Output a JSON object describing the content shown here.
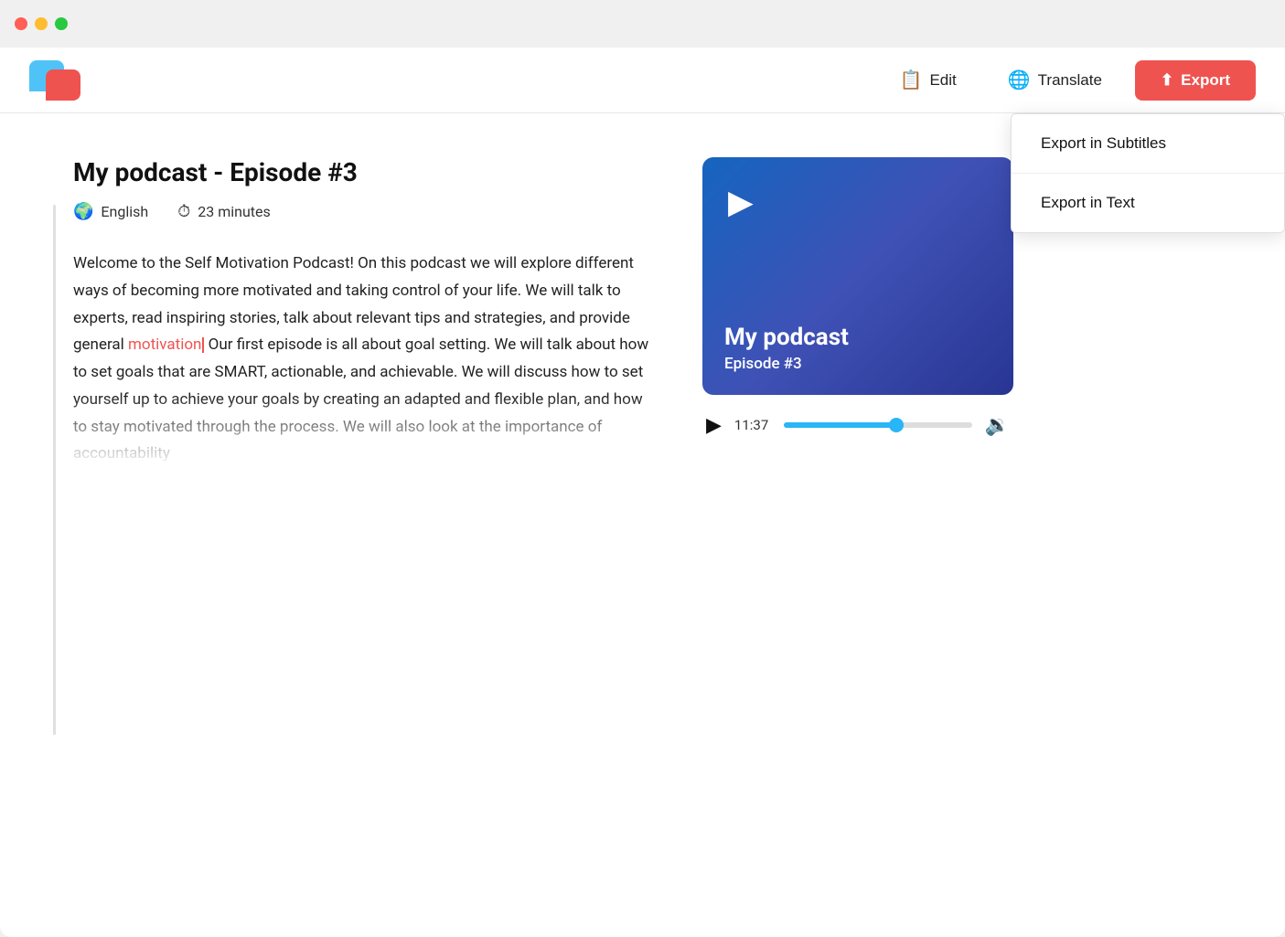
{
  "window": {
    "titlebar": {
      "close_label": "",
      "min_label": "",
      "max_label": ""
    }
  },
  "logo": {
    "alt": "App Logo"
  },
  "navbar": {
    "edit_label": "Edit",
    "translate_label": "Translate",
    "export_label": "Export"
  },
  "dropdown": {
    "export_subtitles": "Export in Subtitles",
    "export_text": "Export in Text"
  },
  "podcast": {
    "title": "My podcast - Episode #3",
    "language": "English",
    "duration": "23 minutes",
    "transcript": "Welcome to the Self Motivation Podcast! On this podcast we will explore different ways of becoming more motivated and taking control of your life. We will talk to experts, read inspiring stories, talk about relevant tips and strategies, and provide general ",
    "highlight": "motivation",
    "transcript_after": " Our first episode is all about goal setting. We will talk about how to set goals that are SMART, actionable, and achievable. We will discuss how to set yourself up to achieve your goals by creating an adapted and flexible plan, and how to stay motivated through the process. We will also look at the importance of accountability",
    "thumbnail_title": "My podcast",
    "thumbnail_subtitle": "Episode #3",
    "current_time": "11:37",
    "progress_percent": 60
  }
}
